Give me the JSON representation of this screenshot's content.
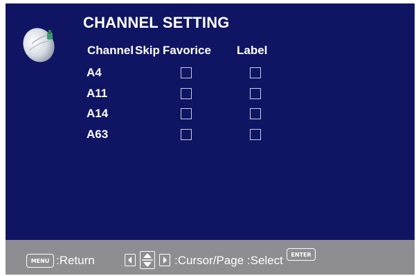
{
  "title": "CHANNEL SETTING",
  "headers": {
    "channel": "Channel",
    "skip": "Skip",
    "favorite": "Favorice",
    "label": "Label"
  },
  "rows": [
    {
      "name": "A4",
      "skip": false,
      "favorite": false
    },
    {
      "name": "A11",
      "skip": false,
      "favorite": false
    },
    {
      "name": "A14",
      "skip": false,
      "favorite": false
    },
    {
      "name": "A63",
      "skip": false,
      "favorite": false
    }
  ],
  "footer": {
    "menu_key": "MENU",
    "return_text": ":Return",
    "cursor_text": ":Cursor/Page :Select",
    "enter_key": "ENTER"
  },
  "colors": {
    "background": "#0f1563",
    "footer": "#8d8d92"
  }
}
